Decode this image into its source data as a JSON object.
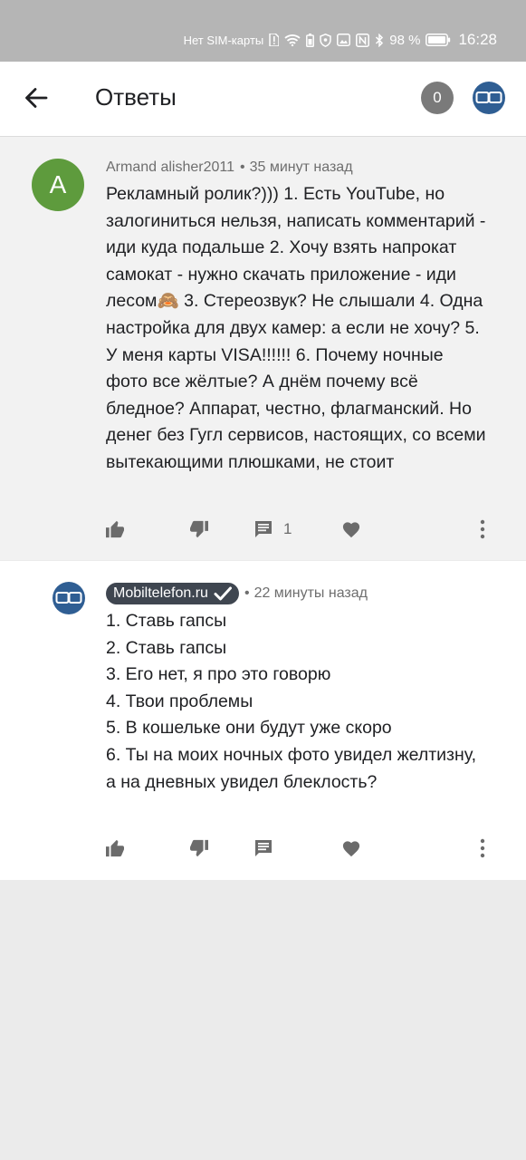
{
  "status_bar": {
    "carrier": "Нет SIM-карты",
    "battery_percent": "98 %",
    "time": "16:28",
    "icons": [
      "sim-alert-icon",
      "wifi-icon",
      "battery-saver-icon",
      "vpn-shield-icon",
      "image-notification-icon",
      "nfc-icon",
      "bluetooth-icon",
      "battery-icon"
    ]
  },
  "app_bar": {
    "title": "Ответы",
    "badge_count": "0",
    "icons": [
      "arrow-back-icon",
      "channel-avatar-icon"
    ]
  },
  "parent_comment": {
    "avatar_letter": "A",
    "avatar_color": "#5e9b3d",
    "author": "Armand alisher2011",
    "time": "35 минут назад",
    "text": "Рекламный ролик?))) 1. Есть YouTube, но залогиниться нельзя, написать комментарий - иди куда подальше 2. Хочу взять напрокат самокат - нужно скачать приложение - иди лесом🙈 3. Стереозвук? Не слышали 4. Одна настройка для двух камер: а если не хочу? 5. У меня карты VISA!!!!!! 6. Почему ночные фото все жёлтые? А днём почему всё бледное? Аппарат, честно, флагманский. Но денег без Гугл сервисов, настоящих, со всеми вытекающими плюшками, не стоит",
    "reply_count": "1"
  },
  "reply": {
    "author": "Mobiltelefon.ru",
    "verified": true,
    "time": "22 минуты назад",
    "lines": [
      "1. Ставь гапсы",
      "2. Ставь гапсы",
      "3. Его нет, я про это говорю",
      "4. Твои проблемы",
      "5. В кошельке они будут уже скоро",
      "6. Ты на моих ночных фото увидел желтизну, а на дневных увидел блеклость?"
    ]
  },
  "colors": {
    "status_bar": "#b5b5b5",
    "channel_blue": "#2f5e93",
    "icon_gray": "#6b6b6b",
    "parent_bg": "#f2f2f2",
    "page_bg": "#ebebeb"
  }
}
